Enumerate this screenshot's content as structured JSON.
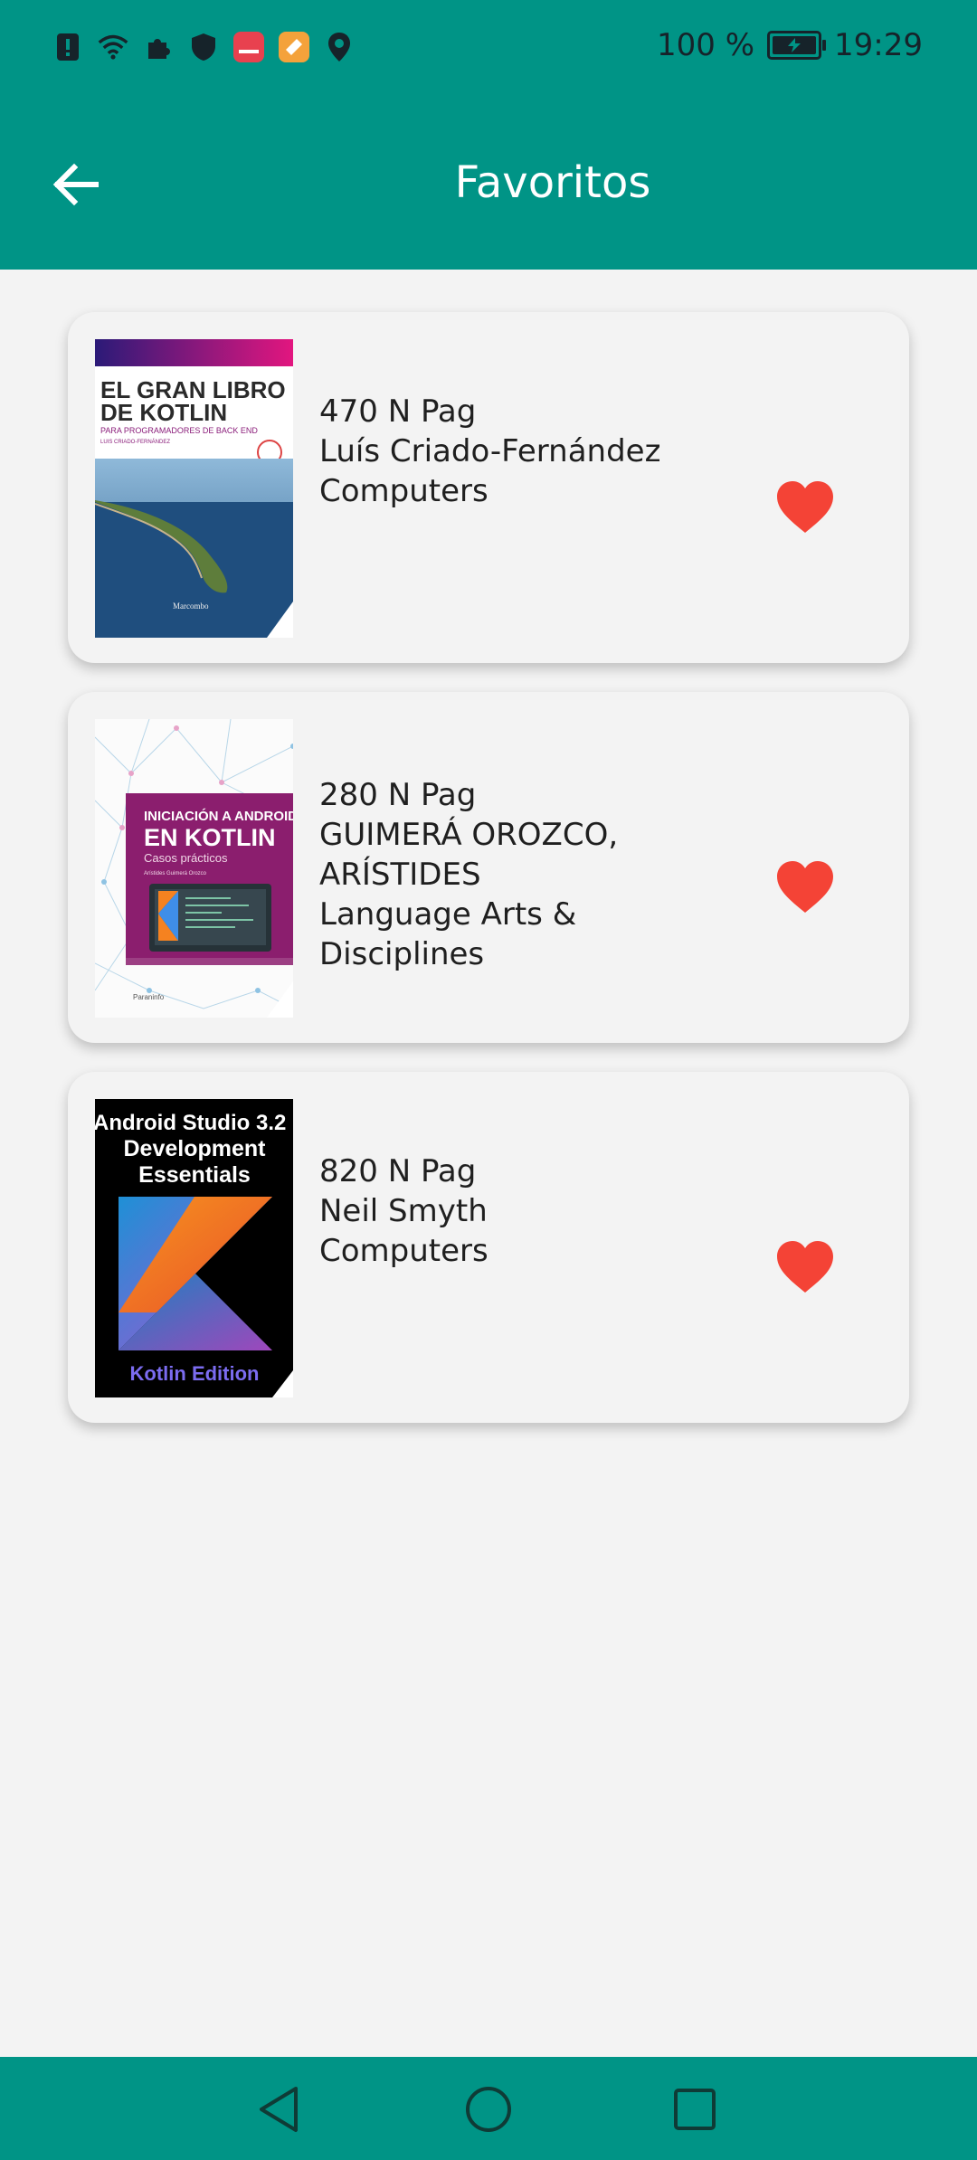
{
  "status_bar": {
    "battery_text": "100 %",
    "time": "19:29",
    "icons": [
      "alert-icon",
      "wifi-icon",
      "puzzle-icon",
      "shield-icon",
      "huawei-app-icon",
      "orange-app-icon",
      "location-icon"
    ]
  },
  "app_bar": {
    "title": "Favoritos",
    "back_icon": "arrow-left-icon"
  },
  "books": [
    {
      "pages": "470 N Pag",
      "author": "Luís Criado-Fernández",
      "category": "Computers",
      "favorite": true,
      "cover": {
        "title_line1": "EL GRAN LIBRO",
        "title_line2": "DE KOTLIN",
        "subtitle": "PARA PROGRAMADORES DE BACK END",
        "author_small": "LUIS CRIADO-FERNÁNDEZ",
        "publisher": "Marcombo"
      }
    },
    {
      "pages": "280 N Pag",
      "author": "GUIMERÁ OROZCO, ARÍSTIDES",
      "category": "Language Arts & Disciplines",
      "favorite": true,
      "cover": {
        "title_line1": "INICIACIÓN A ANDROID",
        "title_line2": "EN KOTLIN",
        "subtitle": "Casos prácticos",
        "author_small": "Arístides Guimerá Orozco",
        "publisher": "Paraninfo"
      }
    },
    {
      "pages": "820 N Pag",
      "author": "Neil Smyth",
      "category": "Computers",
      "favorite": true,
      "cover": {
        "title_line1": "Android Studio 3.2",
        "title_line2": "Development",
        "title_line3": "Essentials",
        "edition": "Kotlin Edition"
      }
    }
  ],
  "colors": {
    "primary": "#009486",
    "background": "#F3F3F3",
    "heart": "#F44336"
  },
  "nav_bar": {
    "icons": [
      "back-triangle-icon",
      "home-circle-icon",
      "recents-square-icon"
    ]
  }
}
